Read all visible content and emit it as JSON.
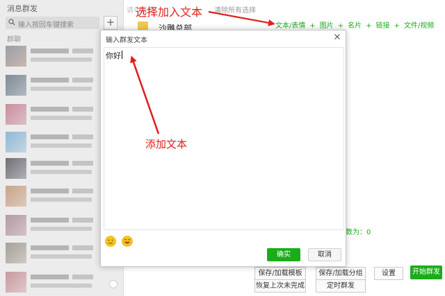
{
  "left_panel": {
    "title": "消息群发",
    "search_placeholder": "输入按回车键搜索",
    "add_label": "+",
    "section_label": "群聊"
  },
  "right_panel": {
    "hint_text_1": "请勾选要",
    "hint_text_2": "清除所有选择",
    "selected_group_name": "沙雕总部",
    "content_types": [
      "文本/表情",
      "图片",
      "名片",
      "链接",
      "文件/视频"
    ],
    "plus_symbol": "+",
    "stats_text": "数为：0",
    "actions": {
      "save_load_template": "保存/加载模板",
      "save_load_group": "保存/加载分组",
      "settings": "设置",
      "start_broadcast": "开始群发",
      "restore_unfinished": "恢复上次未完成",
      "scheduled_broadcast": "定时群发"
    }
  },
  "dialog": {
    "title": "输入群发文本",
    "text_value": "你好",
    "confirm_label": "确实",
    "cancel_label": "取消"
  },
  "annotations": {
    "select_text": "选择加入文本",
    "add_text": "添加文本",
    "color": "#e02020"
  },
  "colors": {
    "accent_green": "#1aad19",
    "panel_gray": "#ececec"
  }
}
